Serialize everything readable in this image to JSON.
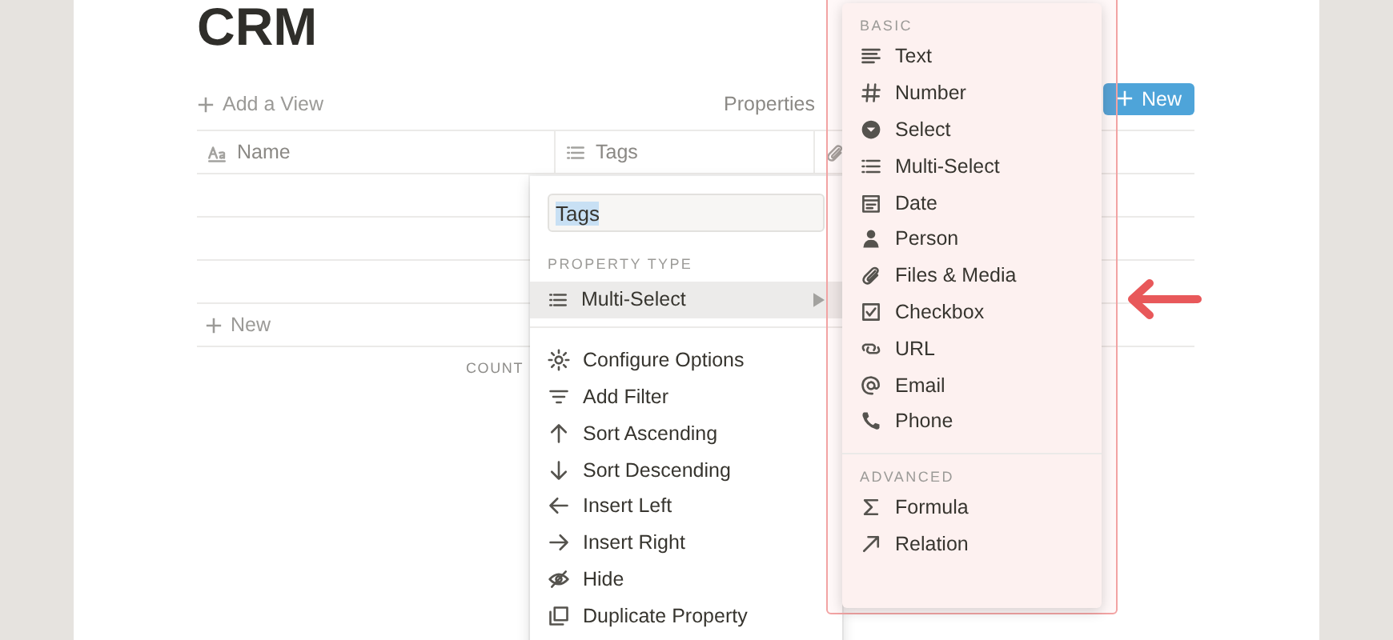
{
  "page": {
    "title": "CRM",
    "add_view": "Add a View",
    "properties": "Properties",
    "new_button": "New"
  },
  "table": {
    "columns": [
      {
        "label": "Name",
        "kind": "title"
      },
      {
        "label": "Tags",
        "kind": "multi"
      },
      {
        "kind": "files"
      }
    ],
    "new_row": "New",
    "footer": "COUNT"
  },
  "property_menu": {
    "name_value": "Tags",
    "section": "PROPERTY TYPE",
    "type": {
      "label": "Multi-Select",
      "kind": "multi"
    },
    "actions": [
      {
        "label": "Configure Options",
        "kind": "gear"
      },
      {
        "label": "Add Filter",
        "kind": "filter"
      },
      {
        "label": "Sort Ascending",
        "kind": "up"
      },
      {
        "label": "Sort Descending",
        "kind": "down"
      },
      {
        "label": "Insert Left",
        "kind": "left"
      },
      {
        "label": "Insert Right",
        "kind": "right"
      },
      {
        "label": "Hide",
        "kind": "hide"
      },
      {
        "label": "Duplicate Property",
        "kind": "duplicate"
      }
    ]
  },
  "type_menu": {
    "sections": [
      {
        "title": "BASIC",
        "items": [
          {
            "label": "Text",
            "kind": "text"
          },
          {
            "label": "Number",
            "kind": "number"
          },
          {
            "label": "Select",
            "kind": "select"
          },
          {
            "label": "Multi-Select",
            "kind": "multi"
          },
          {
            "label": "Date",
            "kind": "date"
          },
          {
            "label": "Person",
            "kind": "person"
          },
          {
            "label": "Files & Media",
            "kind": "files"
          },
          {
            "label": "Checkbox",
            "kind": "checkbox"
          },
          {
            "label": "URL",
            "kind": "url"
          },
          {
            "label": "Email",
            "kind": "email"
          },
          {
            "label": "Phone",
            "kind": "phone"
          }
        ]
      },
      {
        "title": "ADVANCED",
        "items": [
          {
            "label": "Formula",
            "kind": "formula"
          },
          {
            "label": "Relation",
            "kind": "relation"
          }
        ]
      }
    ]
  }
}
